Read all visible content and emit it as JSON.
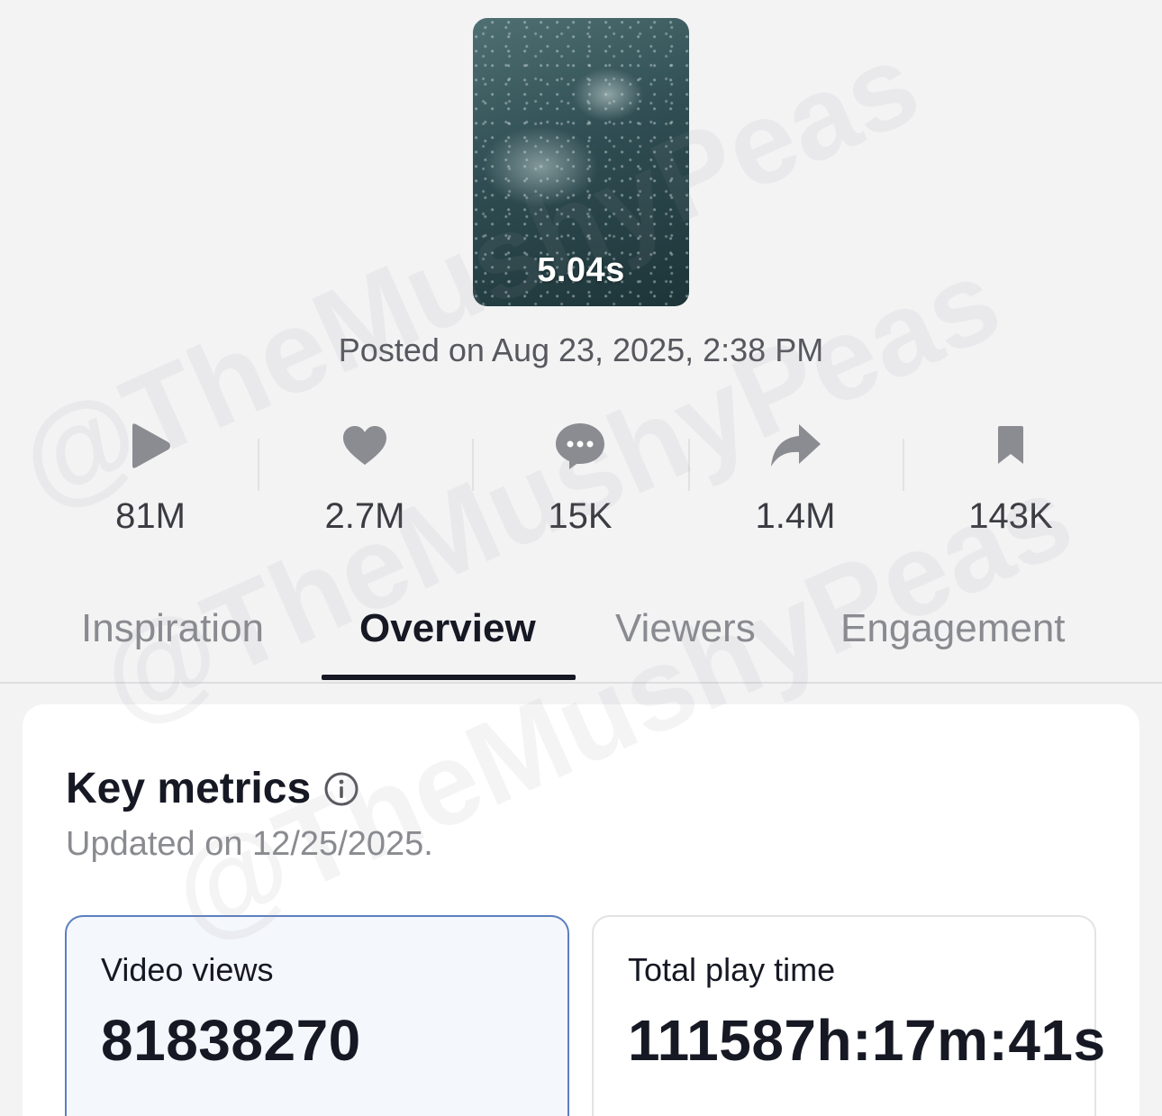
{
  "video": {
    "duration": "5.04s",
    "posted": "Posted on Aug 23, 2025, 2:38 PM"
  },
  "stats": [
    {
      "icon": "play-icon",
      "value": "81M"
    },
    {
      "icon": "heart-icon",
      "value": "2.7M"
    },
    {
      "icon": "comment-icon",
      "value": "15K"
    },
    {
      "icon": "share-icon",
      "value": "1.4M"
    },
    {
      "icon": "bookmark-icon",
      "value": "143K"
    }
  ],
  "tabs": [
    {
      "label": "Inspiration",
      "active": false
    },
    {
      "label": "Overview",
      "active": true
    },
    {
      "label": "Viewers",
      "active": false
    },
    {
      "label": "Engagement",
      "active": false
    }
  ],
  "key_metrics": {
    "title": "Key metrics",
    "updated": "Updated on 12/25/2025.",
    "cards": [
      {
        "label": "Video views",
        "value": "81838270",
        "selected": true
      },
      {
        "label": "Total play time",
        "value": "111587h:17m:41s",
        "selected": false
      }
    ]
  },
  "watermark": "@TheMushyPeas",
  "colors": {
    "background": "#f3f3f4",
    "text": "#161823",
    "muted": "#8a8b90",
    "selected_border": "#5d7fbf"
  }
}
